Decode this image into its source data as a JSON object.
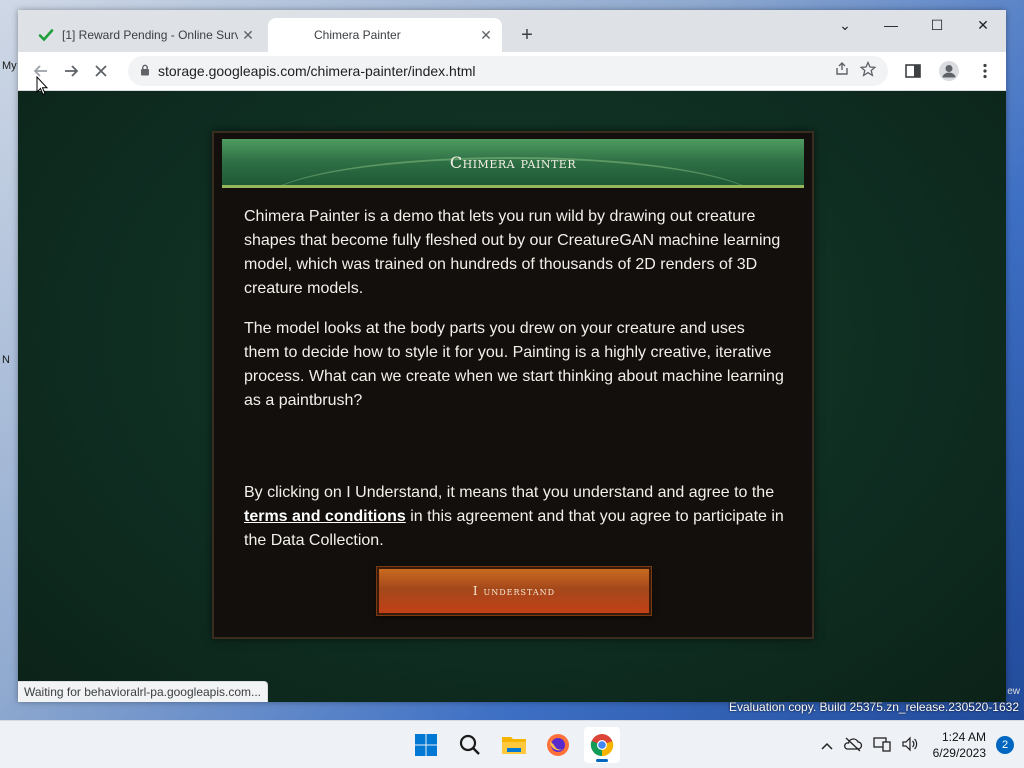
{
  "desktop": {
    "fragment_my": "My",
    "fragment_n": "N",
    "watermark": "Evaluation copy. Build 25375.zn_release.230520-1632",
    "watermark_top": "ew"
  },
  "browser": {
    "tabs": [
      {
        "title": "[1] Reward Pending - Online Surv",
        "icon": "checkmark-icon",
        "close": "✕"
      },
      {
        "title": "Chimera Painter",
        "icon": "none",
        "close": "✕"
      }
    ],
    "new_tab": "+",
    "window_controls": {
      "collapse": "⌄",
      "minimize": "—",
      "maximize": "☐",
      "close": "✕"
    },
    "url": "storage.googleapis.com/chimera-painter/index.html",
    "status": "Waiting for behavioralrl-pa.googleapis.com..."
  },
  "modal": {
    "title": "Chimera painter",
    "paragraphs": [
      "Chimera Painter is a demo that lets you run wild by drawing out creature shapes that become fully fleshed out by our CreatureGAN machine learning model, which was trained on hundreds of thousands of 2D renders of 3D creature models.",
      "The model looks at the body parts you drew on your creature and uses them to decide how to style it for you. Painting is a highly creative, iterative process. What can we create when we start thinking about machine learning as a paintbrush?"
    ],
    "consent_before": "By clicking on I Understand, it means that you understand and agree to the ",
    "consent_link": "terms and conditions",
    "consent_after": " in this agreement and that you agree to participate in the Data Collection.",
    "button": "I understand"
  },
  "taskbar": {
    "time": "1:24 AM",
    "date": "6/29/2023",
    "notifications": "2"
  },
  "colors": {
    "page_bg": "#0f2e22",
    "modal_bg": "#120f0c",
    "header_green": "#2e6f44",
    "button_orange": "#b0521c",
    "accent_blue": "#0067c0"
  }
}
